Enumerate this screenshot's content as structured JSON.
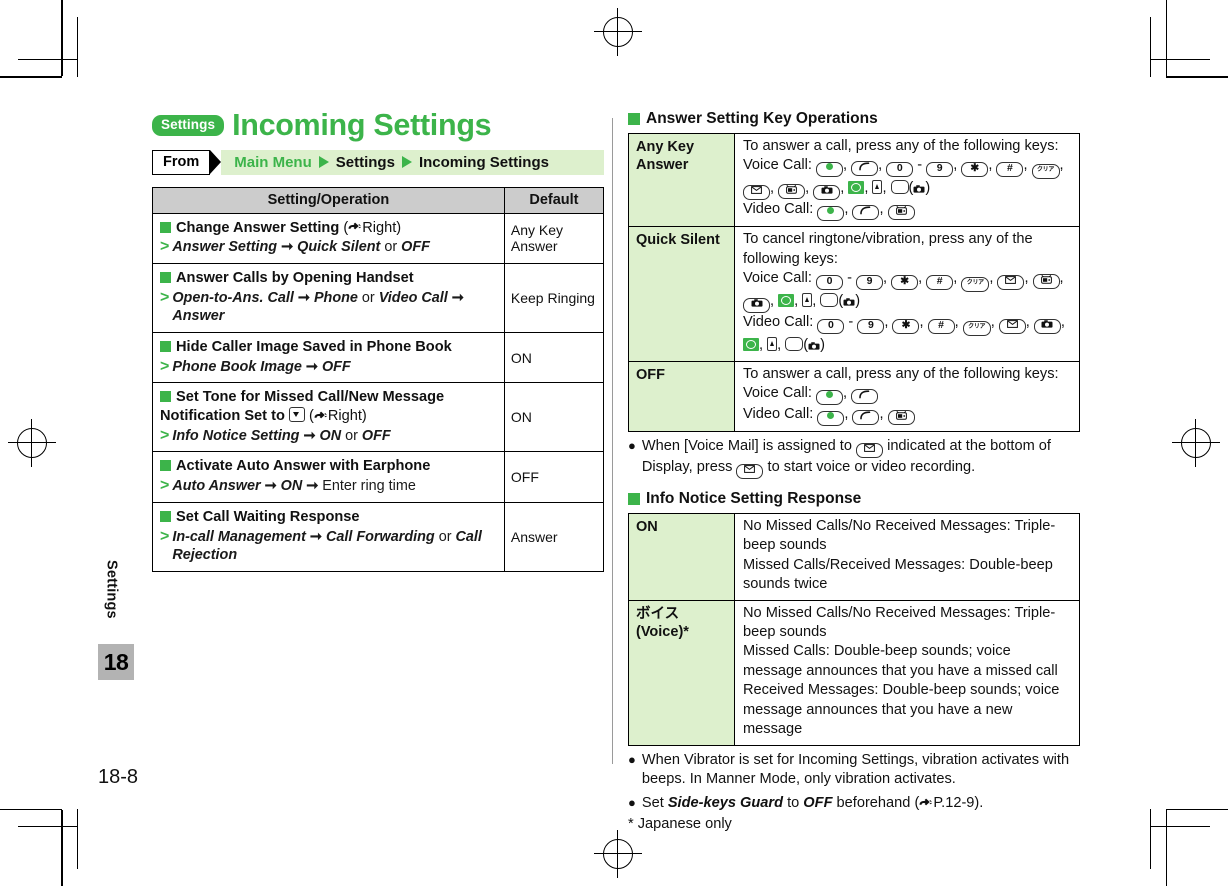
{
  "page": {
    "folio": "18-8",
    "tab_label": "Settings",
    "tab_number": "18"
  },
  "colors": {
    "brand_green": "#3cb44a",
    "breadcrumb_bg": "#ddf0cd",
    "table_header_bg": "#cccccc",
    "tab_bg": "#b3b3b3"
  },
  "title": {
    "chip": "Settings",
    "text": "Incoming Settings"
  },
  "breadcrumb": {
    "from_label": "From",
    "items": [
      "Main Menu",
      "Settings",
      "Incoming Settings"
    ]
  },
  "settings_table": {
    "headers": [
      "Setting/Operation",
      "Default"
    ],
    "rows": [
      {
        "heading": "Change Answer Setting",
        "heading_suffix": "(☞Right)",
        "operation_prefix": "Answer Setting",
        "operation_rest": " ➞ Quick Silent or OFF",
        "operation_parts": [
          {
            "t": "Answer Setting",
            "i": true
          },
          {
            "t": " ➞ ",
            "i": false
          },
          {
            "t": "Quick Silent",
            "i": true
          },
          {
            "t": " or ",
            "i": false
          },
          {
            "t": "OFF",
            "i": true
          }
        ],
        "default": "Any Key Answer"
      },
      {
        "heading": "Answer Calls by Opening Handset",
        "heading_suffix": "",
        "operation_parts": [
          {
            "t": "Open-to-Ans. Call",
            "i": true
          },
          {
            "t": " ➞ ",
            "i": false
          },
          {
            "t": "Phone",
            "i": true
          },
          {
            "t": " or ",
            "i": false
          },
          {
            "t": "Video Call",
            "i": true
          },
          {
            "t": " ➞ ",
            "i": false
          },
          {
            "t": "Answer",
            "i": true
          }
        ],
        "default": "Keep Ringing"
      },
      {
        "heading": "Hide Caller Image Saved in Phone Book",
        "heading_suffix": "",
        "operation_parts": [
          {
            "t": "Phone Book Image",
            "i": true
          },
          {
            "t": " ➞ ",
            "i": false
          },
          {
            "t": "OFF",
            "i": true
          }
        ],
        "default": "ON"
      },
      {
        "heading": "Set Tone for Missed Call/New Message Notification Set to",
        "heading_suffix": "(☞Right)",
        "has_inline_key": true,
        "operation_parts": [
          {
            "t": "Info Notice Setting",
            "i": true
          },
          {
            "t": " ➞ ",
            "i": false
          },
          {
            "t": "ON",
            "i": true
          },
          {
            "t": " or ",
            "i": false
          },
          {
            "t": "OFF",
            "i": true
          }
        ],
        "default": "ON"
      },
      {
        "heading": "Activate Auto Answer with Earphone",
        "heading_suffix": "",
        "operation_parts": [
          {
            "t": "Auto Answer",
            "i": true
          },
          {
            "t": " ➞ ",
            "i": false
          },
          {
            "t": "ON",
            "i": true
          },
          {
            "t": " ➞ ",
            "i": false
          },
          {
            "t": "Enter ring time",
            "i": false
          }
        ],
        "default": "OFF"
      },
      {
        "heading": "Set Call Waiting Response",
        "heading_suffix": "",
        "operation_parts": [
          {
            "t": "In-call Management",
            "i": true
          },
          {
            "t": " ➞ ",
            "i": false
          },
          {
            "t": "Call Forwarding",
            "i": true
          },
          {
            "t": " or ",
            "i": false
          },
          {
            "t": "Call Rejection",
            "i": true
          }
        ],
        "default": "Answer"
      }
    ]
  },
  "answer_key_section": {
    "heading": "Answer Setting Key Operations",
    "rows": [
      {
        "label": "Any Key Answer",
        "intro": "To answer a call, press any of the following keys:",
        "voice_label": "Voice Call:",
        "voice_keys": [
          "center-green",
          "send",
          "0",
          "-",
          "9",
          "star",
          "hash",
          "clear",
          "mail",
          "tv",
          "camera",
          "side-green",
          "up-key",
          "blank",
          "(camera)"
        ],
        "video_label": "Video Call:",
        "video_keys": [
          "center-green",
          "send",
          "tv"
        ]
      },
      {
        "label": "Quick Silent",
        "intro": "To cancel ringtone/vibration, press any of the following keys:",
        "voice_label": "Voice Call:",
        "voice_keys": [
          "0",
          "-",
          "9",
          "star",
          "hash",
          "clear",
          "mail",
          "tv",
          "camera",
          "side-green",
          "up-key",
          "blank",
          "(camera)"
        ],
        "video_label": "Video Call:",
        "video_keys": [
          "0",
          "-",
          "9",
          "star",
          "hash",
          "clear",
          "mail",
          "camera",
          "side-green",
          "up-key",
          "blank",
          "(camera)"
        ]
      },
      {
        "label": "OFF",
        "intro": "To answer a call, press any of the following keys:",
        "voice_label": "Voice Call:",
        "voice_keys": [
          "center-green",
          "send"
        ],
        "video_label": "Video Call:",
        "video_keys": [
          "center-green",
          "send",
          "tv"
        ]
      }
    ],
    "note": {
      "before": "When [Voice Mail] is assigned to",
      "middle": "indicated at the bottom of Display, press",
      "after": "to start voice or video recording."
    }
  },
  "info_notice_section": {
    "heading": "Info Notice Setting Response",
    "rows": [
      {
        "label": "ON",
        "lines": [
          "No Missed Calls/No Received Messages: Triple-beep sounds",
          "Missed Calls/Received Messages: Double-beep sounds twice"
        ]
      },
      {
        "label": "ボイス (Voice)*",
        "label_jp": "ボイス",
        "label_en": "(Voice)*",
        "lines": [
          "No Missed Calls/No Received Messages: Triple-beep sounds",
          "Missed Calls: Double-beep sounds; voice message announces that you have a missed call",
          "Received Messages: Double-beep sounds; voice message announces that you have a new message"
        ]
      }
    ]
  },
  "footnotes": {
    "note1": "When Vibrator is set for Incoming Settings, vibration activates with beeps. In Manner Mode, only vibration activates.",
    "note2_parts": [
      {
        "t": "Set ",
        "b": false
      },
      {
        "t": "Side-keys Guard",
        "b": true
      },
      {
        "t": " to ",
        "b": false
      },
      {
        "t": "OFF",
        "b": true
      },
      {
        "t": " beforehand (☞P.12-9).",
        "b": false
      }
    ],
    "note2_plain": "Set Side-keys Guard to OFF beforehand (☞P.12-9).",
    "star": "* Japanese only"
  }
}
